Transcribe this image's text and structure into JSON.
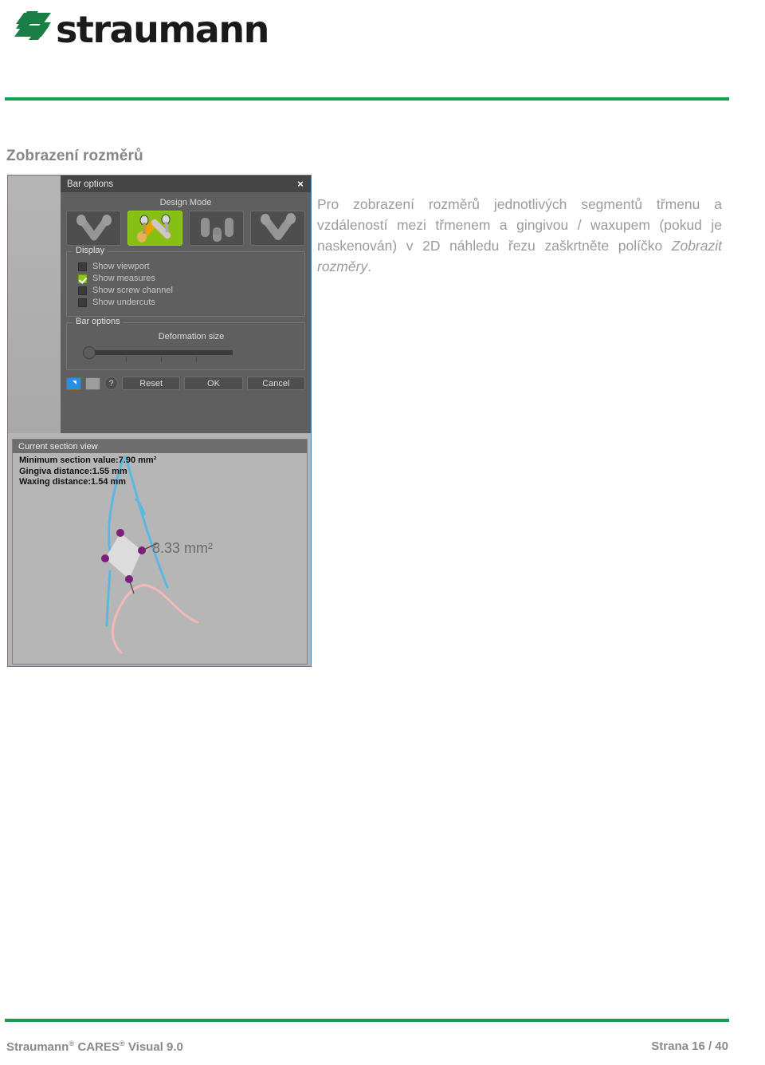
{
  "brand": {
    "logo_text": "straumann",
    "logo_icon": "straumann-s-mark",
    "accent_color": "#13a04f"
  },
  "section": {
    "heading": "Zobrazení rozměrů"
  },
  "body": {
    "paragraph_part1": "Pro zobrazení rozměrů jednotlivých segmentů třmenu a vzdáleností mezi třmenem a gingivou / waxupem (pokud je naskenován) v 2D náhledu řezu zaškrtněte políčko ",
    "paragraph_emphasis": "Zobrazit rozměry",
    "paragraph_part2": "."
  },
  "screenshot": {
    "dialog": {
      "title": "Bar options",
      "close_icon": "×",
      "design_mode_label": "Design Mode",
      "mode_buttons": [
        {
          "name": "bar-shape-1",
          "selected": false
        },
        {
          "name": "bar-shape-2",
          "selected": true
        },
        {
          "name": "bar-shape-3",
          "selected": false
        },
        {
          "name": "bar-shape-4",
          "selected": false
        }
      ],
      "display_group": {
        "legend": "Display",
        "items": [
          {
            "label": "Show viewport",
            "checked": false
          },
          {
            "label": "Show measures",
            "checked": true
          },
          {
            "label": "Show screw channel",
            "checked": false
          },
          {
            "label": "Show undercuts",
            "checked": false
          }
        ]
      },
      "bar_group": {
        "legend": "Bar options",
        "slider_label": "Deformation size",
        "slider_value": 0
      },
      "buttons": {
        "icon1": "arrow-expand-icon",
        "icon2": "color-swatch-icon",
        "help": "?",
        "reset": "Reset",
        "ok": "OK",
        "cancel": "Cancel"
      }
    },
    "section_view": {
      "title": "Current section view",
      "stats": [
        "Minimum section value:7.90 mm²",
        "Gingiva distance:1.55 mm",
        "Waxing distance:1.54 mm"
      ],
      "area_label": "8.33 mm²",
      "curve_colors": {
        "tooth": "#5bb8e0",
        "gingiva": "#f3b8b8",
        "point": "#7b1f7b"
      }
    }
  },
  "footer": {
    "left_product": "Straumann",
    "left_reg1": "®",
    "left_cares": " CARES",
    "left_reg2": "®",
    "left_version": " Visual 9.0",
    "right": "Strana 16 / 40"
  }
}
